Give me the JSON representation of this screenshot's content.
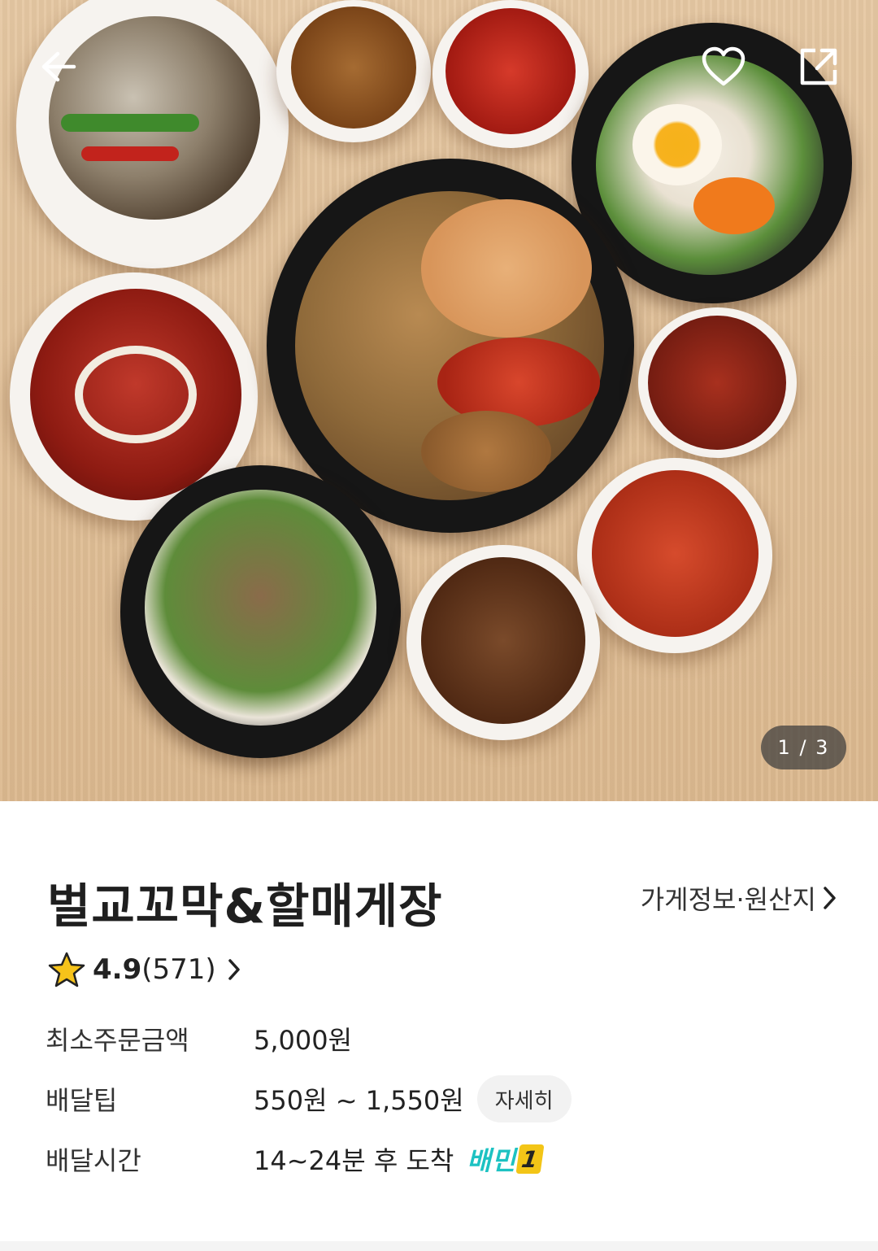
{
  "hero": {
    "page_current": "1",
    "page_total": "3",
    "page_indicator": "1 / 3",
    "icons": [
      "back-arrow-icon",
      "heart-icon",
      "share-icon"
    ]
  },
  "store": {
    "name": "벌교꼬막&할매게장",
    "info_link_label": "가게정보·원산지",
    "rating": {
      "score": "4.9",
      "count": "(571)"
    }
  },
  "details": {
    "min_order": {
      "label": "최소주문금액",
      "value": "5,000원"
    },
    "delivery_tip": {
      "label": "배달팁",
      "value": "550원 ~ 1,550원",
      "detail_button": "자세히"
    },
    "delivery_time": {
      "label": "배달시간",
      "value": "14~24분 후 도착",
      "badge_text": "배민",
      "badge_number": "1"
    }
  },
  "colors": {
    "accent_mint": "#1dc2c2",
    "star_yellow": "#f6c31a",
    "badge_yellow": "#f3c517"
  }
}
